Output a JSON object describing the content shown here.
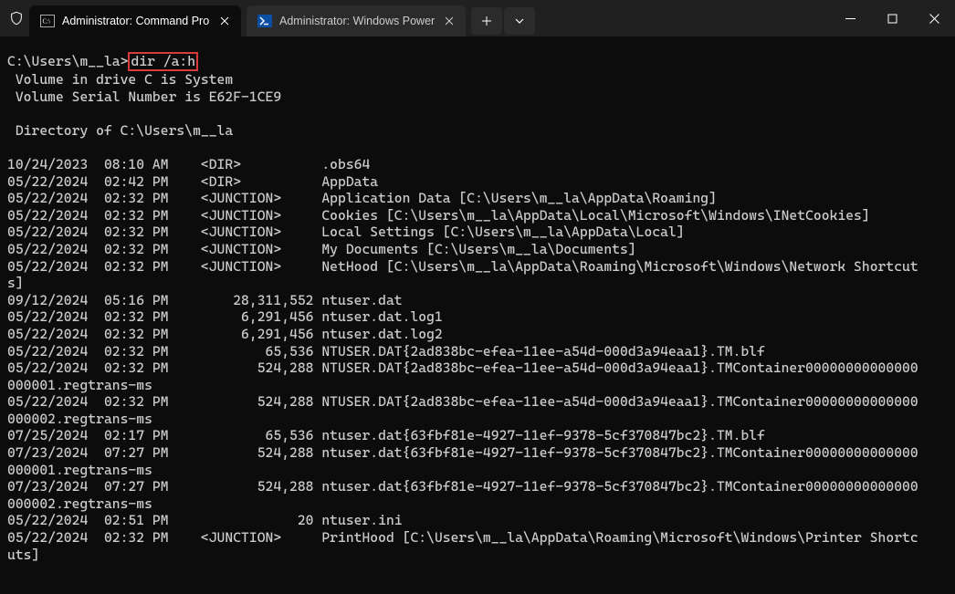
{
  "titlebar": {
    "tabs": [
      {
        "label": "Administrator: Command Pro",
        "icon": "cmd"
      },
      {
        "label": "Administrator: Windows Power",
        "icon": "ps"
      }
    ],
    "newtab_label": "+",
    "dropdown_label": "v"
  },
  "prompt": {
    "path": "C:\\Users\\m__la>",
    "command": "dir /a:h"
  },
  "output_lines": [
    " Volume in drive C is System",
    " Volume Serial Number is E62F-1CE9",
    "",
    " Directory of C:\\Users\\m__la",
    "",
    "10/24/2023  08:10 AM    <DIR>          .obs64",
    "05/22/2024  02:42 PM    <DIR>          AppData",
    "05/22/2024  02:32 PM    <JUNCTION>     Application Data [C:\\Users\\m__la\\AppData\\Roaming]",
    "05/22/2024  02:32 PM    <JUNCTION>     Cookies [C:\\Users\\m__la\\AppData\\Local\\Microsoft\\Windows\\INetCookies]",
    "05/22/2024  02:32 PM    <JUNCTION>     Local Settings [C:\\Users\\m__la\\AppData\\Local]",
    "05/22/2024  02:32 PM    <JUNCTION>     My Documents [C:\\Users\\m__la\\Documents]",
    "05/22/2024  02:32 PM    <JUNCTION>     NetHood [C:\\Users\\m__la\\AppData\\Roaming\\Microsoft\\Windows\\Network Shortcuts]",
    "09/12/2024  05:16 PM        28,311,552 ntuser.dat",
    "05/22/2024  02:32 PM         6,291,456 ntuser.dat.log1",
    "05/22/2024  02:32 PM         6,291,456 ntuser.dat.log2",
    "05/22/2024  02:32 PM            65,536 NTUSER.DAT{2ad838bc-efea-11ee-a54d-000d3a94eaa1}.TM.blf",
    "05/22/2024  02:32 PM           524,288 NTUSER.DAT{2ad838bc-efea-11ee-a54d-000d3a94eaa1}.TMContainer00000000000000000001.regtrans-ms",
    "05/22/2024  02:32 PM           524,288 NTUSER.DAT{2ad838bc-efea-11ee-a54d-000d3a94eaa1}.TMContainer00000000000000000002.regtrans-ms",
    "07/25/2024  02:17 PM            65,536 ntuser.dat{63fbf81e-4927-11ef-9378-5cf370847bc2}.TM.blf",
    "07/23/2024  07:27 PM           524,288 ntuser.dat{63fbf81e-4927-11ef-9378-5cf370847bc2}.TMContainer00000000000000000001.regtrans-ms",
    "07/23/2024  07:27 PM           524,288 ntuser.dat{63fbf81e-4927-11ef-9378-5cf370847bc2}.TMContainer00000000000000000002.regtrans-ms",
    "05/22/2024  02:51 PM                20 ntuser.ini",
    "05/22/2024  02:32 PM    <JUNCTION>     PrintHood [C:\\Users\\m__la\\AppData\\Roaming\\Microsoft\\Windows\\Printer Shortcuts]"
  ]
}
